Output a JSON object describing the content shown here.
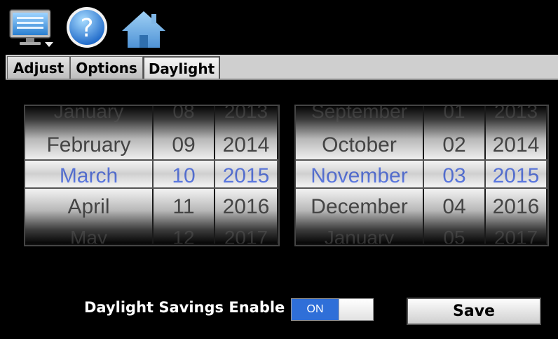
{
  "toolbar": {
    "icons": [
      "monitor-menu-icon",
      "help-icon",
      "home-icon"
    ],
    "help_glyph": "?"
  },
  "tabs": [
    {
      "label": "Adjust",
      "active": false
    },
    {
      "label": "Options",
      "active": false
    },
    {
      "label": "Daylight",
      "active": true
    }
  ],
  "start_date": {
    "month": {
      "items": [
        "January",
        "February",
        "March",
        "April",
        "May"
      ],
      "selected": "March"
    },
    "day": {
      "items": [
        "08",
        "09",
        "10",
        "11",
        "12"
      ],
      "selected": "10"
    },
    "year": {
      "items": [
        "2013",
        "2014",
        "2015",
        "2016",
        "2017"
      ],
      "selected": "2015"
    }
  },
  "end_date": {
    "month": {
      "items": [
        "September",
        "October",
        "November",
        "December",
        "January"
      ],
      "selected": "November"
    },
    "day": {
      "items": [
        "01",
        "02",
        "03",
        "04",
        "05"
      ],
      "selected": "03"
    },
    "year": {
      "items": [
        "2013",
        "2014",
        "2015",
        "2016",
        "2017"
      ],
      "selected": "2015"
    }
  },
  "daylight_savings": {
    "label": "Daylight Savings Enable",
    "state": "ON"
  },
  "save_label": "Save",
  "colors": {
    "selected_text": "#3b62f0",
    "toggle_on": "#2f6fd8",
    "background": "#000000"
  }
}
